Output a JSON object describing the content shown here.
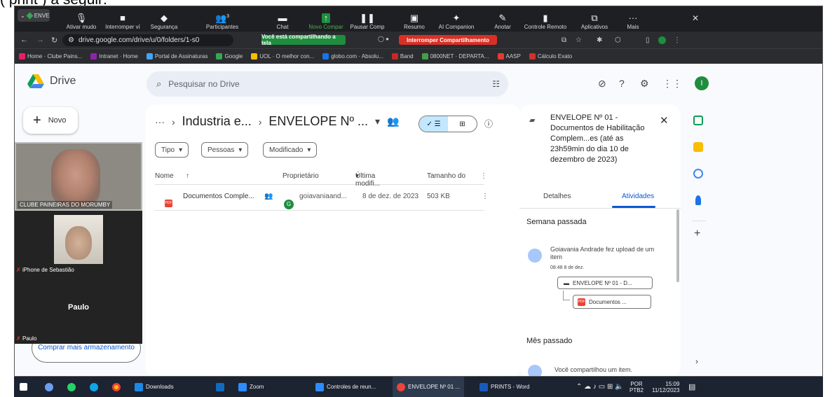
{
  "outer": {
    "caption": "( print ) a seguir:"
  },
  "zoom": {
    "tab_label": "ENVE",
    "items": [
      {
        "label": "Ativar mudo",
        "icon": "microphone-icon"
      },
      {
        "label": "Interromper ví",
        "icon": "camera-icon"
      },
      {
        "label": "Segurança",
        "icon": "shield-icon"
      },
      {
        "label": "Participantes",
        "icon": "people-icon",
        "count": "3"
      },
      {
        "label": "Chat",
        "icon": "chat-icon"
      },
      {
        "label": "Novo Compar",
        "icon": "share-screen-icon"
      },
      {
        "label": "Pausar Comp",
        "icon": "pause-icon"
      },
      {
        "label": "Resumo",
        "icon": "summary-icon"
      },
      {
        "label": "AI Companion",
        "icon": "sparkle-icon"
      },
      {
        "label": "Anotar",
        "icon": "pen-icon"
      },
      {
        "label": "Controle Remoto",
        "icon": "remote-icon"
      },
      {
        "label": "Aplicativos",
        "icon": "apps-icon"
      },
      {
        "label": "Mais",
        "icon": "more-icon"
      }
    ],
    "close_glyph": "✕"
  },
  "chrome": {
    "url": "drive.google.com/drive/u/0/folders/1-s0",
    "sharing_label": "Você está compartilhando a tela",
    "stop_label": "Interromper Compartilhamento"
  },
  "bookmarks": [
    {
      "label": "Home · Clube Pains...",
      "color": "#e91e63"
    },
    {
      "label": "Intranet · Home",
      "color": "#8e24aa"
    },
    {
      "label": "Portal de Assinaturas",
      "color": "#42a5f5"
    },
    {
      "label": "Google",
      "color": "#34a853"
    },
    {
      "label": "UOL · O melhor con...",
      "color": "#fbbc04"
    },
    {
      "label": "globo.com · Absolu...",
      "color": "#1a73e8"
    },
    {
      "label": "Band",
      "color": "#c62828"
    },
    {
      "label": "0800NET · DEPARTA...",
      "color": "#43a047"
    },
    {
      "label": "AASP",
      "color": "#e53935"
    },
    {
      "label": "Cálculo Exato",
      "color": "#d32f2f"
    }
  ],
  "drive": {
    "app_name": "Drive",
    "search_placeholder": "Pesquisar no Drive",
    "avatar_letter": "I",
    "new_label": "Novo",
    "buy_storage_label": "Comprar mais armazenamento",
    "breadcrumb": {
      "more": "···",
      "parent": "Industria e...",
      "current": "ENVELOPE Nº ..."
    },
    "filters": [
      "Tipo",
      "Pessoas",
      "Modificado"
    ],
    "columns": {
      "name": "Nome",
      "owner": "Proprietário",
      "modified": "Última modifi...",
      "size": "Tamanho do"
    },
    "files": [
      {
        "name": "Documentos Comple...",
        "owner_initial": "G",
        "owner": "goiavaniaand...",
        "modified": "8 de dez. de 2023",
        "size": "503 KB"
      }
    ]
  },
  "video": {
    "tile1_label": "CLUBE PAINEIRAS DO MORUMBY",
    "tile2_label": "iPhone de Sebastião",
    "tile3_name": "Paulo",
    "tile3_label": "Paulo"
  },
  "panel": {
    "title": "ENVELOPE Nº 01 - Documentos de Habilitação Complem...es (até as 23h59min do dia 10 de dezembro de 2023)",
    "tab_details": "Detalhes",
    "tab_activity": "Atividades",
    "section_last_week": "Semana passada",
    "activity_text": "Goiavania Andrade fez upload de um item",
    "activity_time": "08:48 8 de dez.",
    "activity_folder": "ENVELOPE Nº 01 - D...",
    "activity_file": "Documentos ...",
    "section_last_month": "Mês passado",
    "activity2_text": "Você compartilhou um item."
  },
  "taskbar": {
    "items": [
      {
        "label": "Downloads",
        "color": "#1e88e5"
      },
      {
        "label": "",
        "color": "#0f6cbd"
      },
      {
        "label": "Zoom",
        "color": "#2d8cff"
      },
      {
        "label": "Controles de reun...",
        "color": "#2d8cff"
      },
      {
        "label": "ENVELOPE Nº 01 ...",
        "color": "#e8453c"
      },
      {
        "label": "PRINTS - Word",
        "color": "#185abd"
      }
    ],
    "lang": "POR",
    "lang2": "PTB2",
    "time": "15:09",
    "date": "11/12/2023"
  }
}
